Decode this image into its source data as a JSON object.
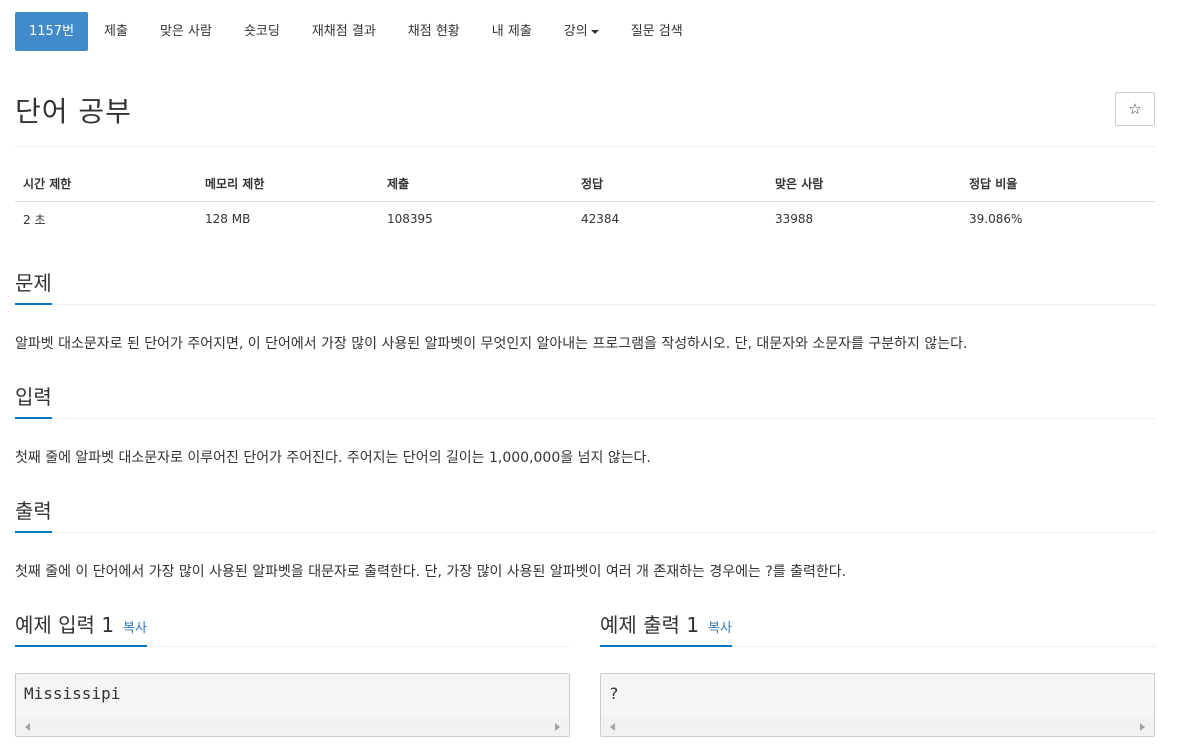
{
  "nav": {
    "problem_id": "1157번",
    "submit": "제출",
    "solved_users": "맞은 사람",
    "short_coding": "숏코딩",
    "rejudge_results": "재채점 결과",
    "rejudge_status": "채점 현황",
    "my_submissions": "내 제출",
    "lectures": "강의",
    "question_search": "질문 검색"
  },
  "problem": {
    "title": "단어 공부",
    "star_icon": "☆"
  },
  "info_table": {
    "headers": [
      "시간 제한",
      "메모리 제한",
      "제출",
      "정답",
      "맞은 사람",
      "정답 비율"
    ],
    "values": [
      "2 초",
      "128 MB",
      "108395",
      "42384",
      "33988",
      "39.086%"
    ]
  },
  "sections": {
    "description": {
      "heading": "문제",
      "text": "알파벳 대소문자로 된 단어가 주어지면, 이 단어에서 가장 많이 사용된 알파벳이 무엇인지 알아내는 프로그램을 작성하시오. 단, 대문자와 소문자를 구분하지 않는다."
    },
    "input": {
      "heading": "입력",
      "text": "첫째 줄에 알파벳 대소문자로 이루어진 단어가 주어진다. 주어지는 단어의 길이는 1,000,000을 넘지 않는다."
    },
    "output": {
      "heading": "출력",
      "text": "첫째 줄에 이 단어에서 가장 많이 사용된 알파벳을 대문자로 출력한다. 단, 가장 많이 사용된 알파벳이 여러 개 존재하는 경우에는 ?를 출력한다."
    }
  },
  "samples": {
    "input": {
      "heading": "예제 입력 1",
      "copy_label": "복사",
      "content": "Mississipi"
    },
    "output": {
      "heading": "예제 출력 1",
      "copy_label": "복사",
      "content": "?"
    }
  }
}
